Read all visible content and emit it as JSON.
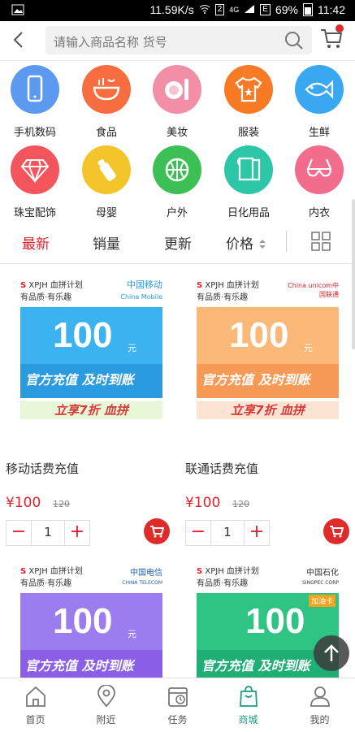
{
  "statusbar": {
    "speed": "11.59K/s",
    "network": "4G",
    "battery": "69%",
    "time": "11:42",
    "sim": "2"
  },
  "search": {
    "placeholder": "请输入商品名称 货号"
  },
  "categories": [
    {
      "label": "手机数码",
      "color": "#5b9af0",
      "icon": "phone-icon"
    },
    {
      "label": "食品",
      "color": "#f86d3f",
      "icon": "bowl-icon"
    },
    {
      "label": "美妆",
      "color": "#f38ea7",
      "icon": "makeup-icon"
    },
    {
      "label": "服装",
      "color": "#f97a25",
      "icon": "shirt-icon"
    },
    {
      "label": "生鲜",
      "color": "#3aa8f0",
      "icon": "fish-icon"
    },
    {
      "label": "珠宝配饰",
      "color": "#f4545b",
      "icon": "diamond-icon"
    },
    {
      "label": "母婴",
      "color": "#f3c52b",
      "icon": "bottle-icon"
    },
    {
      "label": "户外",
      "color": "#3cc055",
      "icon": "ball-icon"
    },
    {
      "label": "日化用品",
      "color": "#2dc6a7",
      "icon": "tissue-icon"
    },
    {
      "label": "内衣",
      "color": "#f26d8c",
      "icon": "bra-icon"
    }
  ],
  "sort": {
    "latest": "最新",
    "sales": "销量",
    "update": "更新",
    "price": "价格"
  },
  "products": [
    {
      "title": "移动话费充值",
      "price": "¥100",
      "old_price": "120",
      "qty": "1",
      "amount": "100",
      "unit": "元",
      "brand": "中国移动",
      "brand_en": "China Mobile",
      "color": "#2b9be0",
      "top": "#3cb3f0",
      "slogan": "官方充值 及时到账",
      "promo": "立享7折 血拼",
      "qty_minus": "−",
      "qty_plus": "+"
    },
    {
      "title": "联通话费充值",
      "price": "¥100",
      "old_price": "120",
      "qty": "1",
      "amount": "100",
      "unit": "元",
      "brand": "China unicom中国联通",
      "brand_en": "",
      "color": "#f79a55",
      "top": "#fbb878",
      "slogan": "官方充值 及时到账",
      "promo": "立享7折 血拼",
      "qty_minus": "−",
      "qty_plus": "+"
    },
    {
      "amount": "100",
      "unit": "元",
      "brand": "中国电信",
      "brand_en": "CHINA TELECOM",
      "color": "#8b5ee8",
      "top": "#9c7df0",
      "slogan": "官方充值 及时到账"
    },
    {
      "amount": "100",
      "unit": "元",
      "brand": "中国石化",
      "brand_en": "SINOPEC CORP",
      "color": "#1fae74",
      "top": "#2fc484",
      "slogan": "官方充值 及时到账",
      "badge": "加油卡"
    }
  ],
  "banner_logo": {
    "xpjh": "XPJH 血拼计划",
    "tag": "有品质·有乐趣"
  },
  "tabs": [
    {
      "label": "首页",
      "icon": "home-icon"
    },
    {
      "label": "附近",
      "icon": "location-icon"
    },
    {
      "label": "任务",
      "icon": "task-icon"
    },
    {
      "label": "商城",
      "icon": "store-icon"
    },
    {
      "label": "我的",
      "icon": "user-icon"
    }
  ],
  "colors": {
    "accent": "#e0202d",
    "tab_active": "#1f9c86"
  }
}
